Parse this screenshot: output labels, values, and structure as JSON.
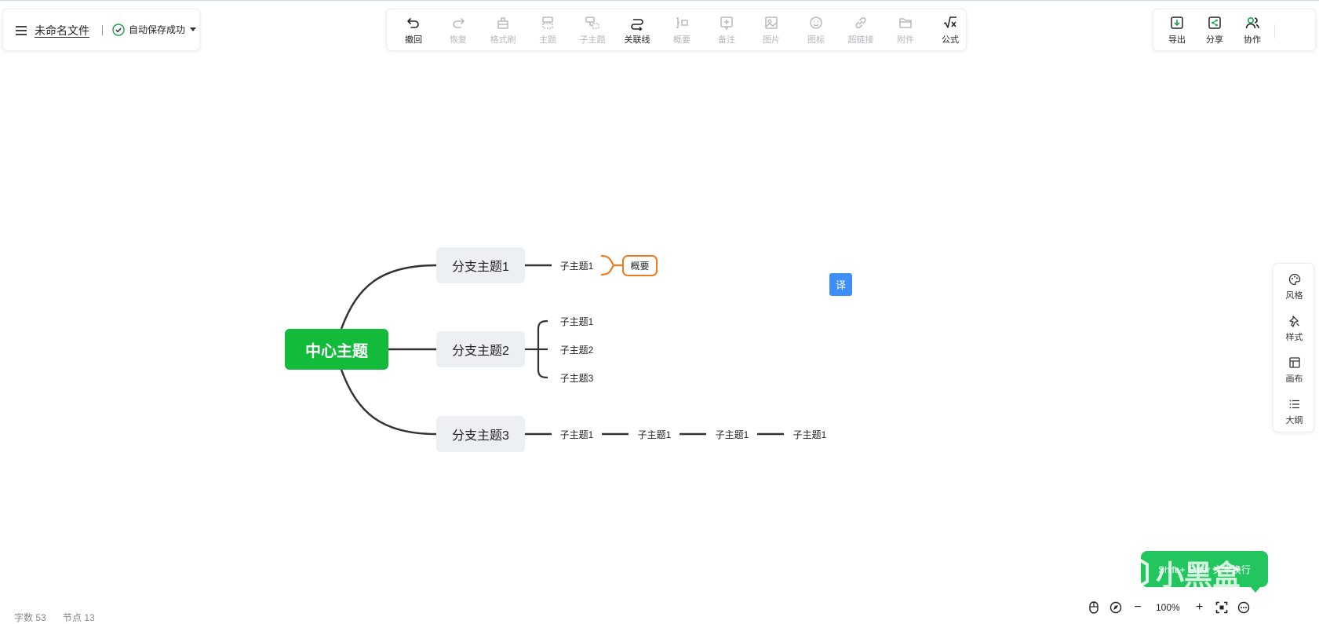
{
  "file": {
    "name": "未命名文件",
    "save_status": "自动保存成功"
  },
  "toolbar": [
    {
      "label": "撤回",
      "icon": "undo-icon",
      "enabled": true
    },
    {
      "label": "恢复",
      "icon": "redo-icon",
      "enabled": false
    },
    {
      "label": "格式刷",
      "icon": "format-painter-icon",
      "enabled": false
    },
    {
      "label": "主题",
      "icon": "topic-icon",
      "enabled": false
    },
    {
      "label": "子主题",
      "icon": "subtopic-icon",
      "enabled": false
    },
    {
      "label": "关联线",
      "icon": "relation-line-icon",
      "enabled": true
    },
    {
      "label": "概要",
      "icon": "summary-icon",
      "enabled": false
    },
    {
      "label": "备注",
      "icon": "note-icon",
      "enabled": false
    },
    {
      "label": "图片",
      "icon": "image-icon",
      "enabled": false
    },
    {
      "label": "图标",
      "icon": "emoji-icon",
      "enabled": false
    },
    {
      "label": "超链接",
      "icon": "link-icon",
      "enabled": false
    },
    {
      "label": "附件",
      "icon": "attachment-icon",
      "enabled": false
    },
    {
      "label": "公式",
      "icon": "formula-icon",
      "enabled": true
    }
  ],
  "share_panel": [
    {
      "label": "导出",
      "icon": "export-icon"
    },
    {
      "label": "分享",
      "icon": "share-icon"
    },
    {
      "label": "协作",
      "icon": "collaborate-icon"
    }
  ],
  "right_rail": [
    {
      "label": "风格",
      "icon": "palette-icon"
    },
    {
      "label": "样式",
      "icon": "style-icon"
    },
    {
      "label": "画布",
      "icon": "canvas-icon"
    },
    {
      "label": "大纲",
      "icon": "outline-icon"
    }
  ],
  "mindmap": {
    "root": "中心主题",
    "branches": [
      {
        "label": "分支主题1",
        "children": [
          "子主题1"
        ],
        "summary": "概要"
      },
      {
        "label": "分支主题2",
        "children": [
          "子主题1",
          "子主题2",
          "子主题3"
        ]
      },
      {
        "label": "分支主题3",
        "children": [
          "子主题1",
          "子主题1",
          "子主题1",
          "子主题1"
        ]
      }
    ]
  },
  "translate_button": "译",
  "status": {
    "word_count": "字数 53",
    "node_count": "节点 13"
  },
  "zoom": {
    "value": "100%"
  },
  "toast": "Shift + Enter 文本换行",
  "watermark": "小黑盒",
  "colors": {
    "root": "#13bb3a",
    "branch_bg": "#edf0f3",
    "summary_border": "#ef7c1f",
    "line": "#333333",
    "accent_green": "#1aa34a"
  }
}
